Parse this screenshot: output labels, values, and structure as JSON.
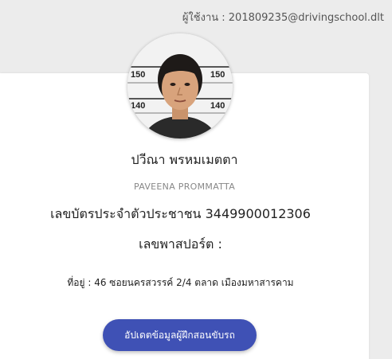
{
  "header": {
    "user_label": "ผู้ใช้งาน : 201809235@drivingschool.dlt"
  },
  "profile": {
    "photo_icon": "person-photo",
    "photo_ruler_marks": [
      "150",
      "150",
      "140",
      "140"
    ],
    "name_th": "ปวีณา พรหมเมตตา",
    "name_en": "PAVEENA PROMMATTA",
    "id_card": "เลขบัตรประจำตัวประชาชน 3449900012306",
    "passport": "เลขพาสปอร์ต :",
    "address": "ที่อยู่ : 46 ซอยนครสวรรค์ 2/4 ตลาด เมืองมหาสารคาม"
  },
  "actions": {
    "update_label": "อัปเดตข้อมูลผู้ฝึกสอนขับรถ"
  },
  "colors": {
    "button": "#3f51b5",
    "background": "#ececec",
    "card": "#ffffff"
  }
}
